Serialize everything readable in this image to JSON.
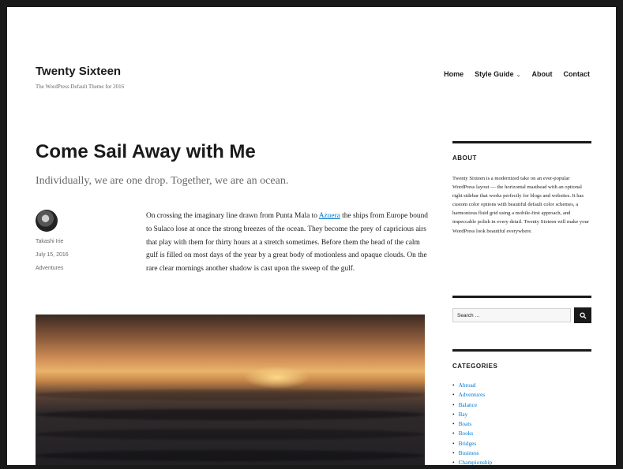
{
  "site": {
    "title": "Twenty Sixteen",
    "tagline": "The WordPress Default Theme for 2016"
  },
  "nav": {
    "items": [
      "Home",
      "Style Guide",
      "About",
      "Contact"
    ]
  },
  "post": {
    "title": "Come Sail Away with Me",
    "summary": "Individually, we are one drop. Together, we are an ocean.",
    "author": "Takashi Irie",
    "date": "July 15, 2016",
    "category": "Adventures",
    "content_before_link": "On crossing the imaginary line drawn from Punta Mala to ",
    "content_link": "Azuera",
    "content_after_link": " the ships from Europe bound to Sulaco lose at once the strong breezes of the ocean. They become the prey of capricious airs that play with them for thirty hours at a stretch sometimes. Before them the head of the calm gulf is filled on most days of the year by a great body of motionless and opaque clouds. On the rare clear mornings another shadow is cast upon the sweep of the gulf."
  },
  "sidebar": {
    "about_title": "ABOUT",
    "about_text": "Twenty Sixteen is a modernized take on an ever-popular WordPress layout — the horizontal masthead with an optional right sidebar that works perfectly for blogs and websites. It has custom color options with beautiful default color schemes, a harmonious fluid grid using a mobile-first approach, and impeccable polish in every detail. Twenty Sixteen will make your WordPress look beautiful everywhere.",
    "search_placeholder": "Search …",
    "categories_title": "CATEGORIES",
    "categories": [
      "Abroad",
      "Adventures",
      "Balance",
      "Bay",
      "Boats",
      "Books",
      "Bridges",
      "Business",
      "Championship"
    ]
  },
  "icons": {
    "nav_dropdown": "chevron-down-icon",
    "search": "search-icon"
  },
  "colors": {
    "text": "#1a1a1a",
    "secondary_text": "#686868",
    "link": "#007acc"
  }
}
